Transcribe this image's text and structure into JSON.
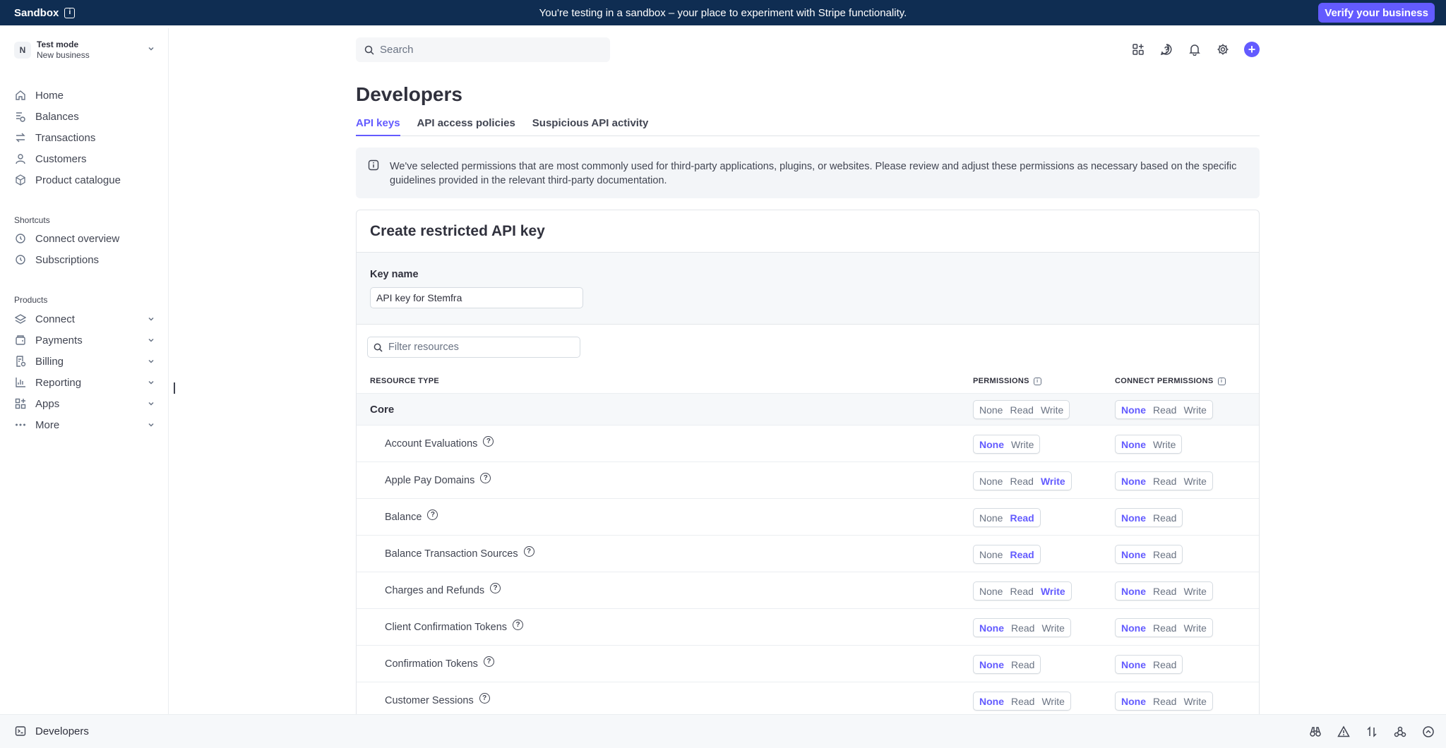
{
  "banner": {
    "label": "Sandbox",
    "message": "You're testing in a sandbox – your place to experiment with Stripe functionality.",
    "verify_label": "Verify your business"
  },
  "account": {
    "initial": "N",
    "mode": "Test mode",
    "name": "New business"
  },
  "sidebar": {
    "items": [
      {
        "label": "Home",
        "icon": "home-icon"
      },
      {
        "label": "Balances",
        "icon": "balances-icon"
      },
      {
        "label": "Transactions",
        "icon": "transactions-icon"
      },
      {
        "label": "Customers",
        "icon": "customers-icon"
      },
      {
        "label": "Product catalogue",
        "icon": "product-catalogue-icon"
      }
    ],
    "shortcuts_heading": "Shortcuts",
    "shortcuts": [
      {
        "label": "Connect overview",
        "icon": "clock-icon"
      },
      {
        "label": "Subscriptions",
        "icon": "clock-icon"
      }
    ],
    "products_heading": "Products",
    "products": [
      {
        "label": "Connect",
        "icon": "connect-icon"
      },
      {
        "label": "Payments",
        "icon": "payments-icon"
      },
      {
        "label": "Billing",
        "icon": "billing-icon"
      },
      {
        "label": "Reporting",
        "icon": "reporting-icon"
      },
      {
        "label": "Apps",
        "icon": "apps-icon"
      },
      {
        "label": "More",
        "icon": "more-icon"
      }
    ]
  },
  "bottom": {
    "developers_label": "Developers"
  },
  "search": {
    "placeholder": "Search"
  },
  "page": {
    "title": "Developers",
    "tabs": [
      {
        "label": "API keys",
        "active": true
      },
      {
        "label": "API access policies",
        "active": false
      },
      {
        "label": "Suspicious API activity",
        "active": false
      }
    ],
    "notice": "We've selected permissions that are most commonly used for third-party applications, plugins, or websites. Please review and adjust these permissions as necessary based on the specific guidelines provided in the relevant third-party documentation."
  },
  "card": {
    "title": "Create restricted API key",
    "key_name_label": "Key name",
    "key_name_value": "API key for Stemfra",
    "filter_placeholder": "Filter resources",
    "col_resource": "RESOURCE TYPE",
    "col_permissions": "PERMISSIONS",
    "col_connect": "CONNECT PERMISSIONS"
  },
  "rows": [
    {
      "name": "Core",
      "group": true,
      "perm": {
        "options": [
          "None",
          "Read",
          "Write"
        ],
        "selected": null
      },
      "connect": {
        "options": [
          "None",
          "Read",
          "Write"
        ],
        "selected": "None"
      }
    },
    {
      "name": "Account Evaluations",
      "group": false,
      "perm": {
        "options": [
          "None",
          "Write"
        ],
        "selected": "None"
      },
      "connect": {
        "options": [
          "None",
          "Write"
        ],
        "selected": "None"
      }
    },
    {
      "name": "Apple Pay Domains",
      "group": false,
      "perm": {
        "options": [
          "None",
          "Read",
          "Write"
        ],
        "selected": "Write"
      },
      "connect": {
        "options": [
          "None",
          "Read",
          "Write"
        ],
        "selected": "None"
      }
    },
    {
      "name": "Balance",
      "group": false,
      "perm": {
        "options": [
          "None",
          "Read"
        ],
        "selected": "Read"
      },
      "connect": {
        "options": [
          "None",
          "Read"
        ],
        "selected": "None"
      }
    },
    {
      "name": "Balance Transaction Sources",
      "group": false,
      "perm": {
        "options": [
          "None",
          "Read"
        ],
        "selected": "Read"
      },
      "connect": {
        "options": [
          "None",
          "Read"
        ],
        "selected": "None"
      }
    },
    {
      "name": "Charges and Refunds",
      "group": false,
      "perm": {
        "options": [
          "None",
          "Read",
          "Write"
        ],
        "selected": "Write"
      },
      "connect": {
        "options": [
          "None",
          "Read",
          "Write"
        ],
        "selected": "None"
      }
    },
    {
      "name": "Client Confirmation Tokens",
      "group": false,
      "perm": {
        "options": [
          "None",
          "Read",
          "Write"
        ],
        "selected": "None"
      },
      "connect": {
        "options": [
          "None",
          "Read",
          "Write"
        ],
        "selected": "None"
      }
    },
    {
      "name": "Confirmation Tokens",
      "group": false,
      "perm": {
        "options": [
          "None",
          "Read"
        ],
        "selected": "None"
      },
      "connect": {
        "options": [
          "None",
          "Read"
        ],
        "selected": "None"
      }
    },
    {
      "name": "Customer Sessions",
      "group": false,
      "perm": {
        "options": [
          "None",
          "Read",
          "Write"
        ],
        "selected": "None"
      },
      "connect": {
        "options": [
          "None",
          "Read",
          "Write"
        ],
        "selected": "None"
      }
    }
  ],
  "colors": {
    "banner": "#0f2d52",
    "accent": "#635bff"
  }
}
